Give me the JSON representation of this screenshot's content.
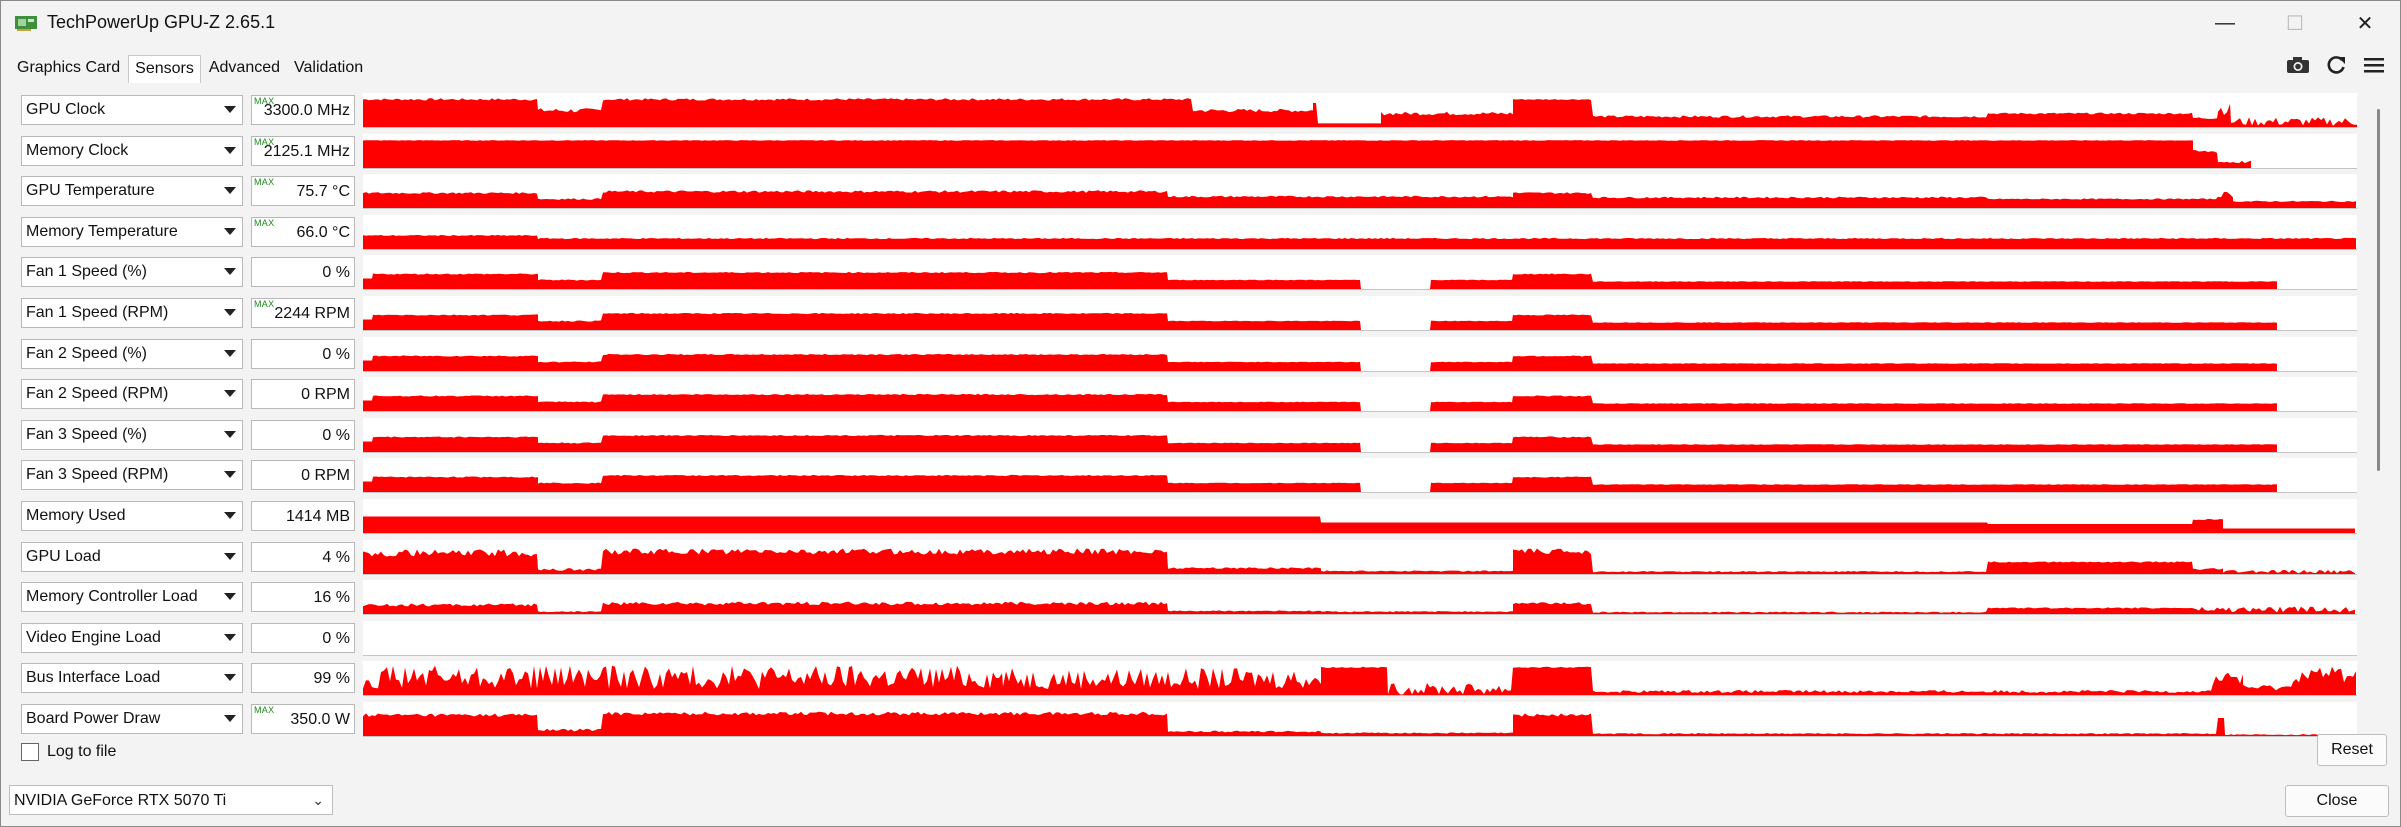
{
  "window": {
    "title": "TechPowerUp GPU-Z 2.65.1",
    "icons": {
      "app": "gpu-card-icon",
      "minimize": "minimize-icon",
      "maximize": "maximize-icon",
      "close": "close-icon"
    }
  },
  "tabs": [
    {
      "label": "Graphics Card",
      "active": false
    },
    {
      "label": "Sensors",
      "active": true
    },
    {
      "label": "Advanced",
      "active": false
    },
    {
      "label": "Validation",
      "active": false
    }
  ],
  "toolbar": {
    "camera_icon": "camera-icon",
    "refresh_icon": "refresh-icon",
    "menu_icon": "hamburger-menu-icon"
  },
  "graph_color": "#ff0000",
  "max_tag": "MAX",
  "sensors": [
    {
      "name": "GPU Clock",
      "value": "3300.0 MHz",
      "max": true,
      "profile": "clock"
    },
    {
      "name": "Memory Clock",
      "value": "2125.1 MHz",
      "max": true,
      "profile": "memclock"
    },
    {
      "name": "GPU Temperature",
      "value": "75.7 °C",
      "max": true,
      "profile": "temp"
    },
    {
      "name": "Memory Temperature",
      "value": "66.0 °C",
      "max": true,
      "profile": "memtemp"
    },
    {
      "name": "Fan 1 Speed (%)",
      "value": "0 %",
      "max": false,
      "profile": "fan"
    },
    {
      "name": "Fan 1 Speed (RPM)",
      "value": "2244 RPM",
      "max": true,
      "profile": "fan"
    },
    {
      "name": "Fan 2 Speed (%)",
      "value": "0 %",
      "max": false,
      "profile": "fan"
    },
    {
      "name": "Fan 2 Speed (RPM)",
      "value": "0 RPM",
      "max": false,
      "profile": "fan"
    },
    {
      "name": "Fan 3 Speed (%)",
      "value": "0 %",
      "max": false,
      "profile": "fan"
    },
    {
      "name": "Fan 3 Speed (RPM)",
      "value": "0 RPM",
      "max": false,
      "profile": "fan"
    },
    {
      "name": "Memory Used",
      "value": "1414 MB",
      "max": false,
      "profile": "memused"
    },
    {
      "name": "GPU Load",
      "value": "4 %",
      "max": false,
      "profile": "load"
    },
    {
      "name": "Memory Controller Load",
      "value": "16 %",
      "max": false,
      "profile": "memload"
    },
    {
      "name": "Video Engine Load",
      "value": "0 %",
      "max": false,
      "profile": "none"
    },
    {
      "name": "Bus Interface Load",
      "value": "99 %",
      "max": false,
      "profile": "bus"
    },
    {
      "name": "Board Power Draw",
      "value": "350.0 W",
      "max": true,
      "profile": "power"
    }
  ],
  "footer": {
    "log_to_file": "Log to file",
    "log_checked": false,
    "reset": "Reset",
    "gpu_selected": "NVIDIA GeForce RTX 5070 Ti",
    "gpu_chevron_icon": "chevron-down-icon",
    "close": "Close"
  }
}
